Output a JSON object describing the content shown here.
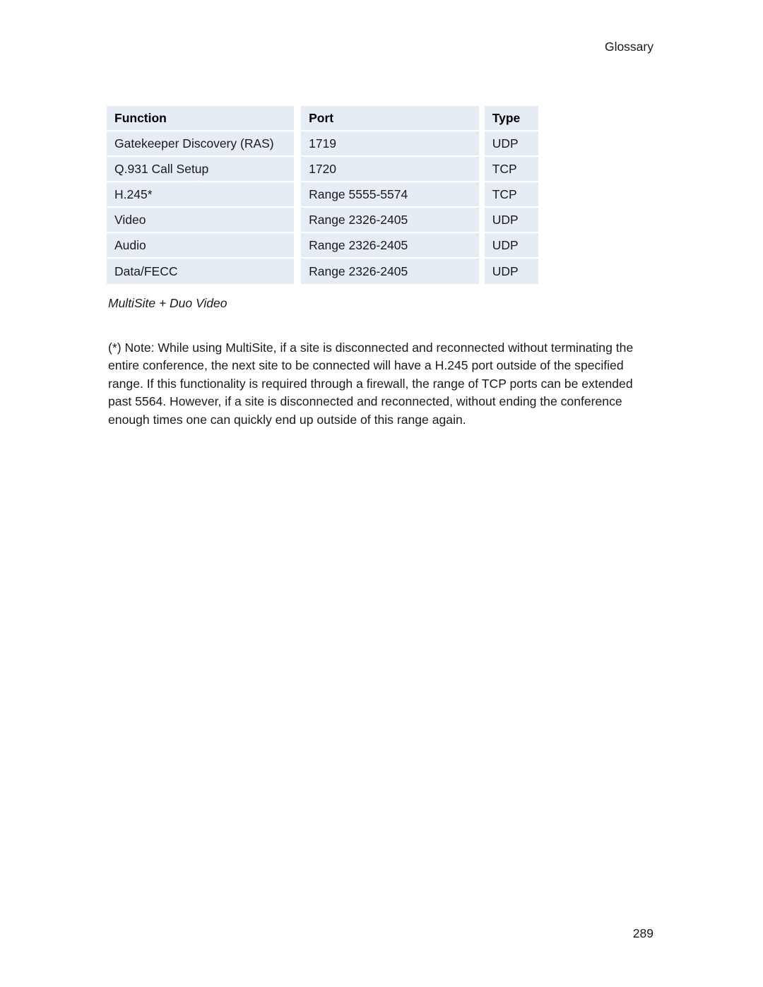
{
  "page": {
    "running_head": "Glossary",
    "page_number": "289",
    "background_color": "#ffffff"
  },
  "table": {
    "cell_background": "#e6ecf4",
    "columns": [
      "Function",
      "Port",
      "Type"
    ],
    "rows": [
      {
        "function": "Gatekeeper Discovery (RAS)",
        "port": "1719",
        "type": "UDP"
      },
      {
        "function": "Q.931 Call Setup",
        "port": "1720",
        "type": "TCP"
      },
      {
        "function": "H.245*",
        "port": "Range 5555-5574",
        "type": "TCP"
      },
      {
        "function": "Video",
        "port": "Range 2326-2405",
        "type": "UDP"
      },
      {
        "function": "Audio",
        "port": "Range 2326-2405",
        "type": "UDP"
      },
      {
        "function": "Data/FECC",
        "port": "Range 2326-2405",
        "type": "UDP"
      }
    ],
    "caption": "MultiSite + Duo Video"
  },
  "note": {
    "text": "(*) Note: While using MultiSite, if a site is disconnected and reconnected without terminating the entire conference, the next site to be connected will have a H.245 port outside of the specified range. If this functionality is required through a firewall, the range of TCP ports can be extended past 5564. However, if a site is disconnected and reconnected, without ending the conference enough times one can quickly end up outside of this range again."
  }
}
